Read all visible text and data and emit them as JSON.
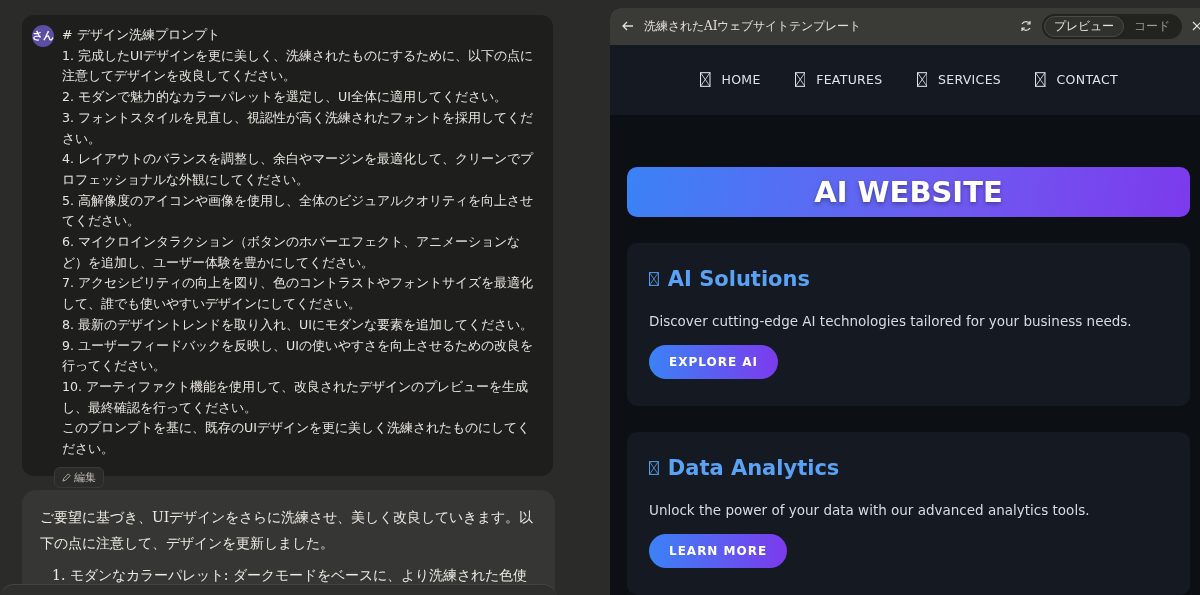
{
  "prompt_message": {
    "avatar": "さん",
    "heading": "# デザイン洗練プロンプト",
    "lines": [
      "1. 完成したUIデザインを更に美しく、洗練されたものにするために、以下の点に注意してデザインを改良してください。",
      "2. モダンで魅力的なカラーパレットを選定し、UI全体に適用してください。",
      "3. フォントスタイルを見直し、視認性が高く洗練されたフォントを採用してください。",
      "4. レイアウトのバランスを調整し、余白やマージンを最適化して、クリーンでプロフェッショナルな外観にしてください。",
      "5. 高解像度のアイコンや画像を使用し、全体のビジュアルクオリティを向上させてください。",
      "6. マイクロインタラクション（ボタンのホバーエフェクト、アニメーションなど）を追加し、ユーザー体験を豊かにしてください。",
      "7. アクセシビリティの向上を図り、色のコントラストやフォントサイズを最適化して、誰でも使いやすいデザインにしてください。",
      "8. 最新のデザイントレンドを取り入れ、UIにモダンな要素を追加してください。",
      "9. ユーザーフィードバックを反映し、UIの使いやすさを向上させるための改良を行ってください。",
      "10. アーティファクト機能を使用して、改良されたデザインのプレビューを生成し、最終確認を行ってください。",
      "このプロンプトを基に、既存のUIデザインを更に美しく洗練されたものにしてください。"
    ],
    "edit_label": "編集"
  },
  "response_message": {
    "intro": "ご要望に基づき、UIデザインをさらに洗練させ、美しく改良していきます。以下の点に注意して、デザインを更新しました。",
    "list_items": [
      "1. モダンなカラーパレット: ダークモードをベースに、より洗練された色使"
    ]
  },
  "artifact": {
    "title": "洗練されたAIウェブサイトテンプレート",
    "tabs": [
      {
        "label": "プレビュー",
        "selected": true
      },
      {
        "label": "コード",
        "selected": false
      }
    ],
    "nav": [
      {
        "label": "HOME"
      },
      {
        "label": "FEATURES"
      },
      {
        "label": "SERVICES"
      },
      {
        "label": "CONTACT"
      }
    ],
    "hero": "AI WEBSITE",
    "cards": [
      {
        "title": "AI Solutions",
        "text": "Discover cutting-edge AI technologies tailored for your business needs.",
        "button": "EXPLORE AI"
      },
      {
        "title": "Data Analytics",
        "text": "Unlock the power of your data with our advanced analytics tools.",
        "button": "LEARN MORE"
      }
    ]
  }
}
